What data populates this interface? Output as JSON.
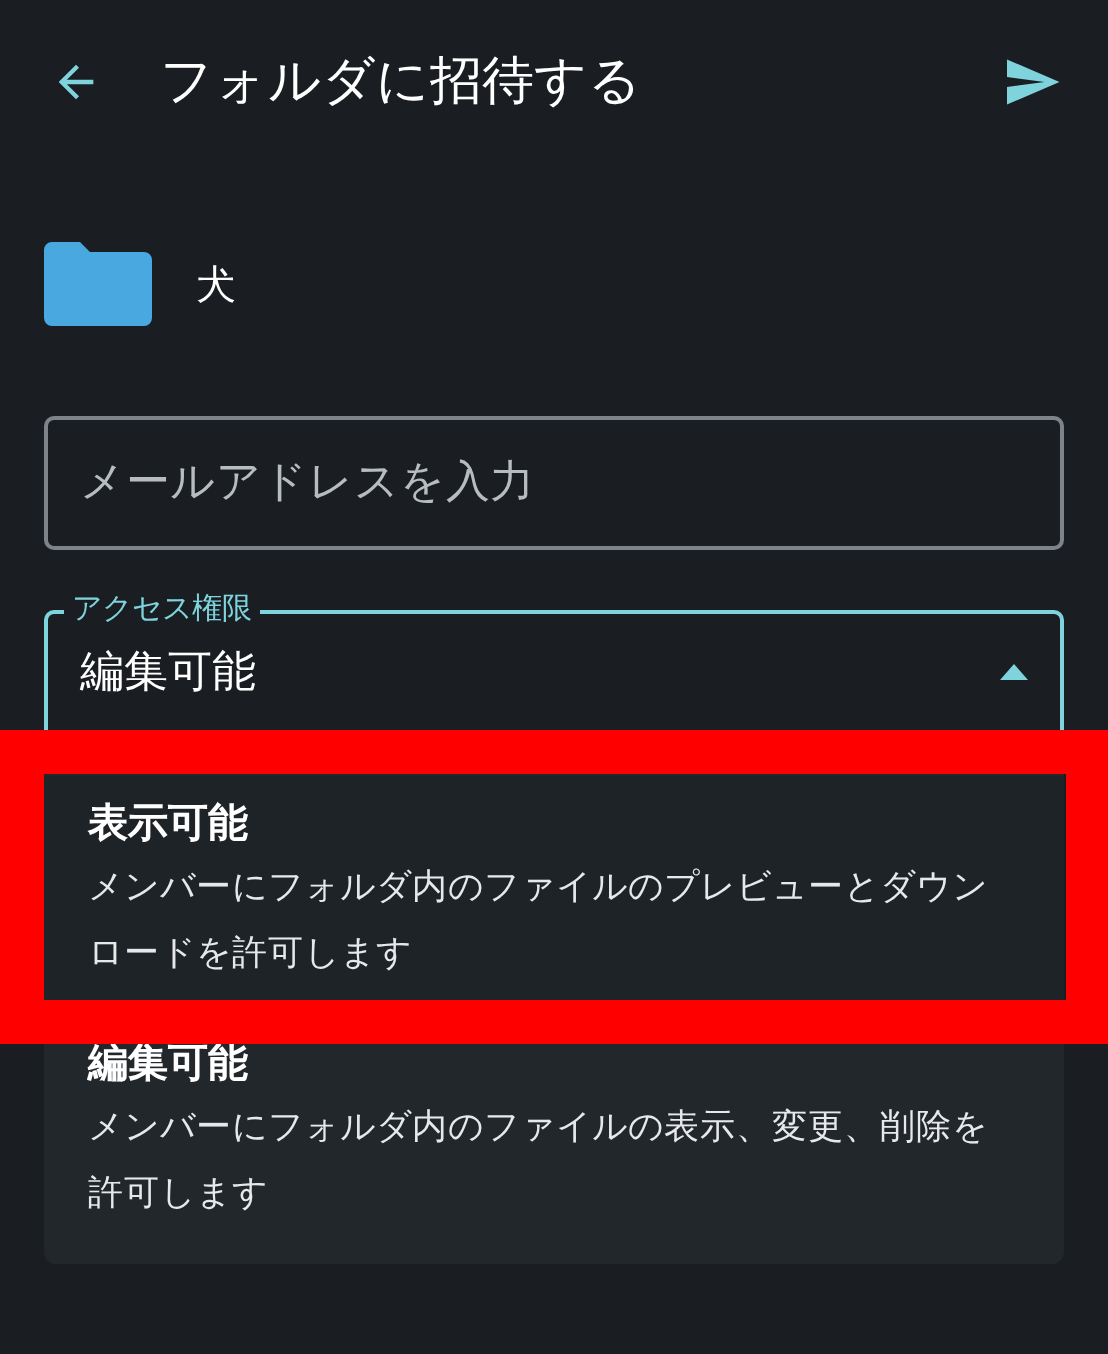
{
  "header": {
    "title": "フォルダに招待する"
  },
  "folder": {
    "name": "犬"
  },
  "email": {
    "placeholder": "メールアドレスを入力"
  },
  "access": {
    "label": "アクセス権限",
    "value": "編集可能",
    "expanded": true
  },
  "options": [
    {
      "title": "表示可能",
      "description": "メンバーにフォルダ内のファイルのプレビューとダウンロードを許可します",
      "highlighted": true
    },
    {
      "title": "編集可能",
      "description": "メンバーにフォルダ内のファイルの表示、変更、削除を許可します",
      "highlighted": false
    }
  ]
}
